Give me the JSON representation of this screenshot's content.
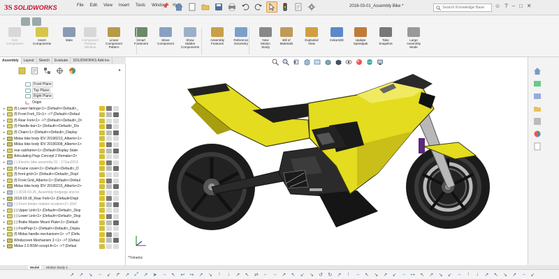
{
  "app": {
    "logo_brand": "SOLIDWORKS",
    "doc_title": "2018-03-01_Assembly Bike *"
  },
  "menu": [
    "File",
    "Edit",
    "View",
    "Insert",
    "Tools",
    "Window",
    "Help"
  ],
  "search": {
    "placeholder": "Search Knowledge Base"
  },
  "ribbon": {
    "buttons": [
      {
        "label": "Edit\nComponent",
        "icon": "edit-component-icon",
        "dim": true
      },
      {
        "label": "Insert\nComponents",
        "icon": "insert-components-icon",
        "dim": false
      },
      {
        "label": "Mate",
        "icon": "mate-icon",
        "dim": false
      },
      {
        "label": "Component\nPreview\nWindow",
        "icon": "component-preview-icon",
        "dim": true
      },
      {
        "label": "Linear\nComponent\nPattern",
        "icon": "linear-pattern-icon",
        "dim": false
      },
      {
        "label": "Smart\nFasteners",
        "icon": "smart-fasteners-icon",
        "dim": false
      },
      {
        "label": "Move\nComponent",
        "icon": "move-component-icon",
        "dim": false
      },
      {
        "label": "Show\nHidden\nComponents",
        "icon": "show-hidden-icon",
        "dim": false
      },
      {
        "label": "Assembly\nFeatures",
        "icon": "assembly-features-icon",
        "dim": false
      },
      {
        "label": "Reference\nGeometry",
        "icon": "reference-geometry-icon",
        "dim": false
      },
      {
        "label": "New\nMotion\nStudy",
        "icon": "motion-study-icon",
        "dim": false
      },
      {
        "label": "Bill of\nMaterials",
        "icon": "bom-icon",
        "dim": false
      },
      {
        "label": "Exploded\nView",
        "icon": "exploded-view-icon",
        "dim": false
      },
      {
        "label": "Instant3D",
        "icon": "instant3d-icon",
        "dim": false
      },
      {
        "label": "Update\nSpeedpak",
        "icon": "speedpak-icon",
        "dim": false
      },
      {
        "label": "Take\nSnapshot",
        "icon": "snapshot-icon",
        "dim": false
      },
      {
        "label": "Large\nAssembly\nMode",
        "icon": "large-assembly-icon",
        "dim": false
      }
    ]
  },
  "fm_tabs": [
    "Assembly",
    "Layout",
    "Sketch",
    "Evaluate",
    "SOLIDWORKS Add-Ins"
  ],
  "tree": [
    {
      "label": "Front Plane",
      "type": "plane"
    },
    {
      "label": "Top Plane",
      "type": "plane"
    },
    {
      "label": "Right Plane",
      "type": "plane"
    },
    {
      "label": "Origin",
      "type": "origin"
    },
    {
      "label": "(f) Lower fairings<1> (Default<<Default>_",
      "type": "part"
    },
    {
      "label": "(f) Front Fork_01<1> ->? (Default<<Defaul",
      "type": "part"
    },
    {
      "label": "(f) Rear Fork<1> ->? (Default<<Default>_Di",
      "type": "part"
    },
    {
      "label": "(f) Handle-bar<1> (Default<<Default>_Dis",
      "type": "part"
    },
    {
      "label": "(f) Chain<1> (Default<<Default>_Display",
      "type": "part"
    },
    {
      "label": "Midas bike body IDV 20190213_Alberto<1>",
      "type": "asm"
    },
    {
      "label": "Midas bike body IDV 20190308_Alberto<1>",
      "type": "asm"
    },
    {
      "label": "rear subframe<1> (Default<Display State-",
      "type": "part"
    },
    {
      "label": "Articulating Pegs Concept 2 Remake<2>",
      "type": "asm"
    },
    {
      "label": "(-) Electric bike assembly 01 - 17Jan2019",
      "type": "dim"
    },
    {
      "label": "(f) Frame cover<1> (Default<<Default>_D",
      "type": "part"
    },
    {
      "label": "(f) front grid<1> (Default<<Default>_Displ",
      "type": "part"
    },
    {
      "label": "(f) Front Grid_Alberto<1> (Default<<Defaul",
      "type": "part"
    },
    {
      "label": "Midas bike body IDV 20190215_Alberto<2>",
      "type": "asm"
    },
    {
      "label": "(-) 2018-03-25_Assembly footpegs and kn",
      "type": "dim"
    },
    {
      "label": "2018-03-18_Rear Fork<1> (Default<Displ",
      "type": "asm"
    },
    {
      "label": "(-) Front fender relative location<2> (Def",
      "type": "dim"
    },
    {
      "label": "(-) Upper Link<1> (Default<<Default>_Disp",
      "type": "part"
    },
    {
      "label": "(-) Lower Link<1> (Default<<Default>_Disp",
      "type": "part"
    },
    {
      "label": "(-) Brake Master Mount Plate<1> (Default",
      "type": "part"
    },
    {
      "label": "(-) FootPeg<1> (Default<<Default>_Displa",
      "type": "part"
    },
    {
      "label": "(f) Midas handle mechanism<1> ->? (Defa",
      "type": "part"
    },
    {
      "label": "Windscreen Mechanism 3 <1> ->? (Defaul",
      "type": "asm"
    },
    {
      "label": "Midas 2.0 BSM cocept A<1> ->? (Defaul",
      "type": "asm"
    }
  ],
  "view": {
    "orientation_label": "*Trimetric"
  },
  "bottom_tabs": [
    "Model",
    "Motion Study 1"
  ],
  "colors": {
    "brand": "#c8102e",
    "fairing": "#e4dc1e",
    "fairing_shadow": "#a89e10",
    "frame": "#2a2a2a"
  }
}
